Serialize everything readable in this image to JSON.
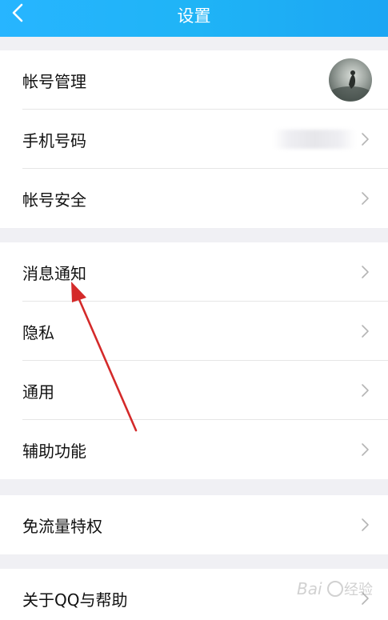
{
  "header": {
    "title": "设置",
    "back_icon": "chevron-left-icon",
    "background": "#1fb4f6"
  },
  "sections": [
    {
      "items": [
        {
          "label": "帐号管理",
          "trailing": "avatar"
        },
        {
          "label": "手机号码",
          "trailing": "blurred-value"
        },
        {
          "label": "帐号安全",
          "trailing": "chevron"
        }
      ]
    },
    {
      "items": [
        {
          "label": "消息通知",
          "trailing": "chevron"
        },
        {
          "label": "隐私",
          "trailing": "chevron"
        },
        {
          "label": "通用",
          "trailing": "chevron"
        },
        {
          "label": "辅助功能",
          "trailing": "chevron"
        }
      ]
    },
    {
      "items": [
        {
          "label": "免流量特权",
          "trailing": "chevron"
        }
      ]
    },
    {
      "items": [
        {
          "label": "关于QQ与帮助",
          "trailing": "chevron"
        }
      ]
    }
  ],
  "annotation": {
    "type": "red-arrow",
    "points_to": "消息通知",
    "color": "#d42a2a"
  },
  "watermark": {
    "text": "Baidu经验"
  }
}
